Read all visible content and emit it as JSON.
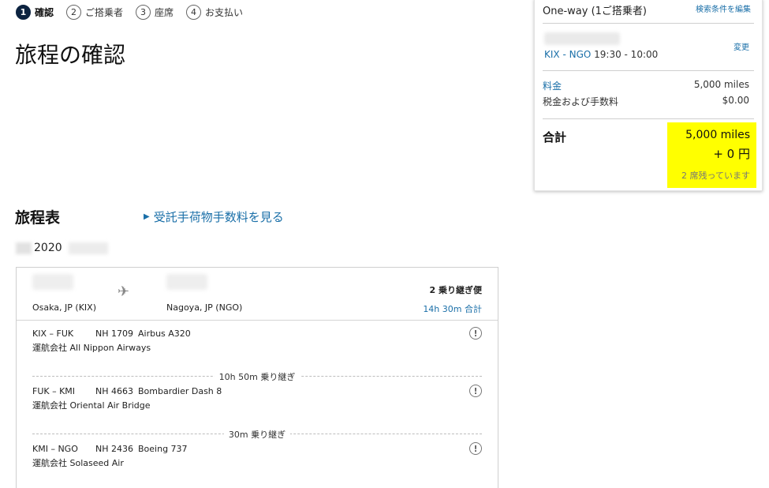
{
  "stepper": {
    "steps": [
      {
        "num": "1",
        "label": "確認"
      },
      {
        "num": "2",
        "label": "ご搭乗者"
      },
      {
        "num": "3",
        "label": "座席"
      },
      {
        "num": "4",
        "label": "お支払い"
      }
    ]
  },
  "page_title": "旅程の確認",
  "summary": {
    "trip_type": "One-way (1ご搭乗者)",
    "edit_search_link": "検索条件を編集",
    "route_codes": "KIX - NGO",
    "route_times": "19:30 - 10:00",
    "change_link": "変更",
    "fare_label": "料金",
    "fare_value": "5,000 miles",
    "taxes_label": "税金および手数料",
    "taxes_value": "$0.00",
    "total_label": "合計",
    "total_miles": "5,000 miles",
    "total_yen": "+ 0 円",
    "seats_left": "2 席残っています"
  },
  "itinerary": {
    "title": "旅程表",
    "baggage_link": "受託手荷物手数料を見る",
    "year": "2020",
    "origin_city": "Osaka, JP (KIX)",
    "destination_city": "Nagoya, JP (NGO)",
    "connections": "2 乗り継ぎ便",
    "total_duration": "14h 30m 合計",
    "segments": [
      {
        "route": "KIX – FUK",
        "flight": "NH 1709",
        "aircraft": "Airbus A320",
        "operator": "運航会社 All Nippon Airways"
      },
      {
        "route": "FUK – KMI",
        "flight": "NH 4663",
        "aircraft": "Bombardier Dash 8",
        "operator": "運航会社 Oriental Air Bridge"
      },
      {
        "route": "KMI – NGO",
        "flight": "NH 2436",
        "aircraft": "Boeing 737",
        "operator": "運航会社 Solaseed Air"
      }
    ],
    "layovers": [
      "10h 50m 乗り継ぎ",
      "30m 乗り継ぎ"
    ]
  },
  "colors": {
    "link": "#1a6fa8",
    "highlight": "#ffff00",
    "active_step": "#0c2340"
  },
  "icons": {
    "plane": "airplane-icon",
    "info": "info-icon",
    "expand": "triangle-right-icon"
  }
}
